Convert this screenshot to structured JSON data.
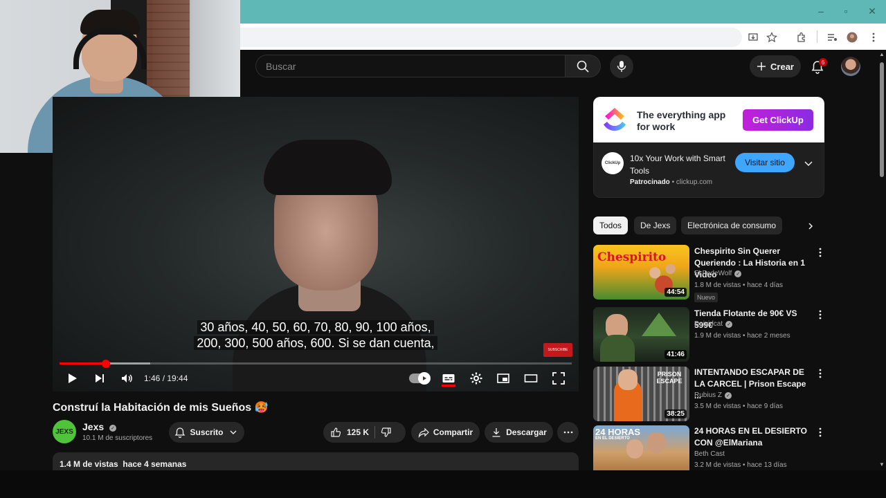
{
  "search": {
    "placeholder": "Buscar"
  },
  "header": {
    "create_label": "Crear",
    "notifications_count": "6"
  },
  "player": {
    "subtitle_line1": "30 años, 40, 50, 60, 70, 80, 90, 100 años,",
    "subtitle_line2": "200, 300, 500 años, 600. Si se dan cuenta,",
    "current_time": "1:46",
    "duration": "19:44",
    "time_display": "1:46 / 19:44",
    "progress_fraction": 0.09,
    "subscribe_badge": "SUBSCRIBE"
  },
  "video": {
    "title": "Construí la Habitación de mis Sueños 🥵",
    "channel_name": "Jexs",
    "channel_avatar_text": "JEXS",
    "subscribers": "10.1 M de suscriptores",
    "subscribed_label": "Suscrito",
    "likes": "125 K",
    "share_label": "Compartir",
    "download_label": "Descargar",
    "views_date": "1.4 M de vistas  hace 4 semanas"
  },
  "ad": {
    "tagline": "The everything app for work",
    "cta": "Get ClickUp",
    "title": "10x Your Work with Smart Tools",
    "sponsored": "Patrocinado",
    "domain": "clickup.com",
    "icon_text": "ClickUp",
    "visit_label": "Visitar sitio"
  },
  "chips": [
    "Todos",
    "De Jexs",
    "Electrónica de consumo"
  ],
  "recommendations": [
    {
      "title": "Chespirito Sin Querer Queriendo : La Historia en 1 Video",
      "channel": "El FedeWolf",
      "meta": "1.8 M de vistas • hace 4 días",
      "duration": "44:54",
      "badge": "Nuevo",
      "thumb_text": "Chespirito"
    },
    {
      "title": "Tienda Flotante de 90€ VS 599€",
      "channel": "Deividcat",
      "meta": "1.9 M de vistas • hace 2 meses",
      "duration": "41:46"
    },
    {
      "title": "INTENTANDO ESCAPAR DE LA CARCEL | Prison Escape ...",
      "channel": "Rubius Z",
      "meta": "3.5 M de vistas • hace 9 días",
      "duration": "38:25",
      "thumb_text": "PRISON ESCAPE"
    },
    {
      "title": "24 HORAS EN EL DESIERTO CON @ElMariana",
      "channel": "Beth Cast",
      "meta": "3.2 M de vistas • hace 13 días",
      "thumb_text": "24 HORAS",
      "thumb_subtext": "EN EL DESIERTO"
    }
  ],
  "colors": {
    "accent_red": "#ff0000",
    "background": "#0f0f0f",
    "chrome_teal": "#5fb8b5",
    "clickup_purple": "#8b2be2",
    "link_blue": "#3ea6ff"
  }
}
